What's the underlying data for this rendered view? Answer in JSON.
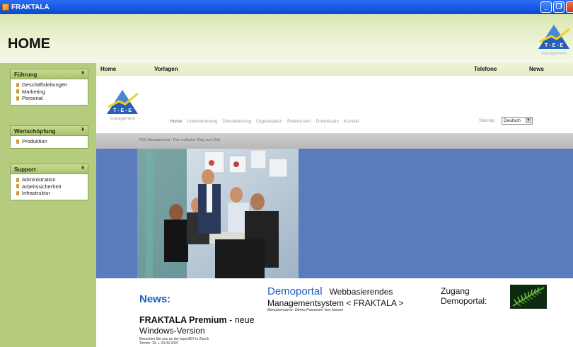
{
  "window": {
    "title": "FRAKTALA"
  },
  "header": {
    "page_title": "HOME",
    "logo_letters": "T - E - E",
    "logo_sub": "management"
  },
  "sidebar": {
    "panels": [
      {
        "title": "Führung",
        "items": [
          "Geschäftsleitungen",
          "Marketing",
          "Personal"
        ]
      },
      {
        "title": "Wertschöpfung",
        "items": [
          "Produktion"
        ]
      },
      {
        "title": "Support",
        "items": [
          "Administration",
          "Arbeitssicherheit",
          "Infrastruktur"
        ]
      }
    ],
    "toggle_glyph": "¥"
  },
  "topmenu": {
    "home": "Home",
    "vorlagen": "Vorlagen",
    "telefone": "Telefone",
    "news": "News"
  },
  "site": {
    "nav": [
      "Home",
      "Unternehmung",
      "Dienstleistung",
      "Organisation",
      "Referenzen",
      "Downloads",
      "Kontakt"
    ],
    "sitemap": "Sitemap",
    "language": "Deutsch",
    "tagline": "TEE Management : Der einfache Weg zum Ziel",
    "news_heading": "News:",
    "news_title_bold": "FRAKTALA Premium",
    "news_title_rest": " - neue",
    "news_sub": "Windows-Version",
    "news_small_1": "Besuchen Sie uns an der topsoft07 in Zürich",
    "news_small_2": "Termin: 19. + 20.09.2007",
    "demo_word": "Demoportal",
    "demo_rest_1": "Webbasierendes",
    "demo_rest_2": "Managementsystem < FRAKTALA >",
    "demo_note": "Benutzername: Demo   Passwort: leer lassen",
    "zugang_1": "Zugang",
    "zugang_2": "Demoportal:"
  },
  "colors": {
    "titlebar": "#0a48d4",
    "sidebar": "#b5cc7e",
    "blue_band": "#5a7cbc",
    "accent_blue": "#1a5cc0"
  }
}
